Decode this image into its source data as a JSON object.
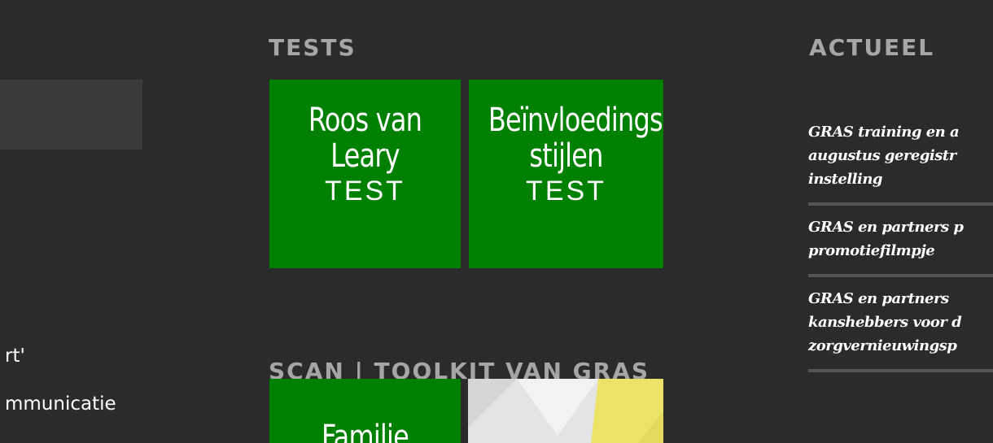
{
  "left_column": {
    "link_1": "rt'",
    "link_2": "mmunicatie"
  },
  "tests": {
    "heading": "TESTS",
    "tiles": [
      {
        "name_line1": "Roos van",
        "name_line2": "Leary",
        "tag": "TEST"
      },
      {
        "name_line1": "Beïnvloedings",
        "name_line2": "stijlen",
        "tag": "TEST"
      }
    ]
  },
  "scan": {
    "heading": "SCAN | TOOLKIT VAN GRAS",
    "tiles": [
      {
        "name_line1": "Familie"
      }
    ]
  },
  "actueel": {
    "heading": "ACTUEEL",
    "items": [
      {
        "line1": "GRAS training en a",
        "line2": "augustus geregistr",
        "line3": "instelling"
      },
      {
        "line1": "GRAS en partners p",
        "line2": "promotiefilmpje"
      },
      {
        "line1": "GRAS en partners",
        "line2": "kanshebbers voor d",
        "line3": "zorgvernieuwingsp"
      }
    ]
  },
  "colors": {
    "background": "#2b2b2b",
    "tile_green": "#008000",
    "heading_grey": "#a6a6a6",
    "divider": "#555555"
  }
}
